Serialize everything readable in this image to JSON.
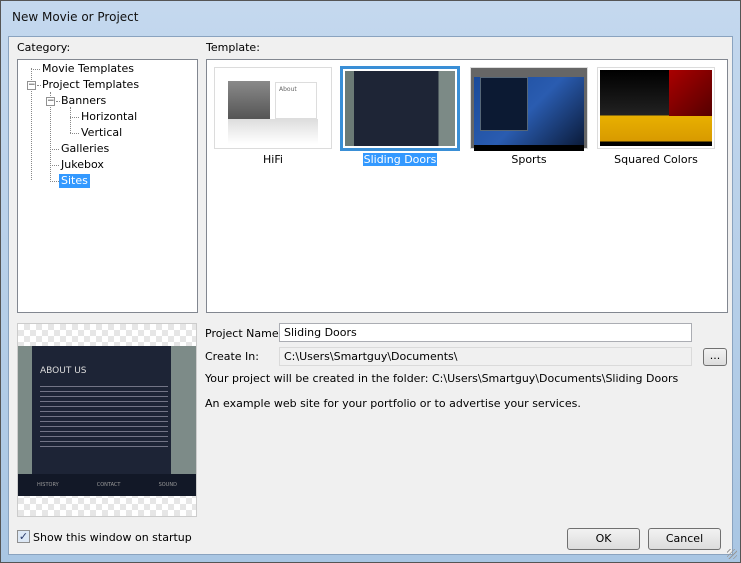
{
  "window": {
    "title": "New Movie or Project"
  },
  "category": {
    "label": "Category:",
    "items": [
      {
        "label": "Movie Templates"
      },
      {
        "label": "Project Templates"
      },
      {
        "label": "Banners"
      },
      {
        "label": "Horizontal"
      },
      {
        "label": "Vertical"
      },
      {
        "label": "Galleries"
      },
      {
        "label": "Jukebox"
      },
      {
        "label": "Sites",
        "selected": true
      }
    ]
  },
  "template": {
    "label": "Template:",
    "items": [
      {
        "label": "HiFi"
      },
      {
        "label": "Sliding Doors",
        "selected": true
      },
      {
        "label": "Sports"
      },
      {
        "label": "Squared Colors"
      }
    ]
  },
  "preview": {
    "heading": "ABOUT US",
    "nav": [
      "HISTORY",
      "CONTACT",
      "SOUND"
    ]
  },
  "form": {
    "project_name_label": "Project Name:",
    "project_name_value": "Sliding Doors",
    "create_in_label": "Create In:",
    "create_in_value": "C:\\Users\\Smartguy\\Documents\\",
    "browse_label": "...",
    "folder_info": "Your project will be created in the folder: C:\\Users\\Smartguy\\Documents\\Sliding Doors",
    "description": "An example web site for your portfolio or to advertise your services."
  },
  "footer": {
    "show_on_startup_label": "Show this window on startup",
    "show_on_startup_checked": true,
    "ok_label": "OK",
    "cancel_label": "Cancel"
  }
}
